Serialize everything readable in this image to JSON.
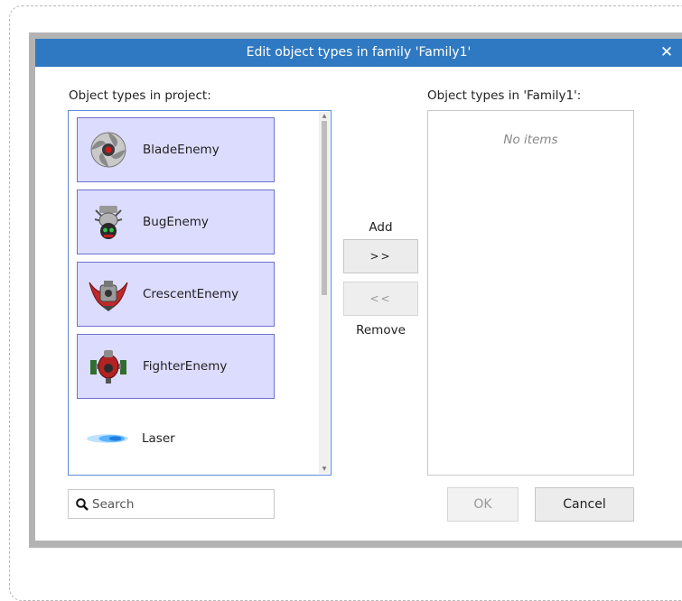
{
  "dialog": {
    "title": "Edit object types in family 'Family1'",
    "close_icon": "close-icon"
  },
  "project_list": {
    "label": "Object types in project:",
    "items": [
      {
        "label": "BladeEnemy",
        "icon": "blade-enemy-icon",
        "selected": true
      },
      {
        "label": "BugEnemy",
        "icon": "bug-enemy-icon",
        "selected": true
      },
      {
        "label": "CrescentEnemy",
        "icon": "crescent-enemy-icon",
        "selected": true
      },
      {
        "label": "FighterEnemy",
        "icon": "fighter-enemy-icon",
        "selected": true
      },
      {
        "label": "Laser",
        "icon": "laser-icon",
        "selected": false
      }
    ]
  },
  "family_list": {
    "label": "Object types in 'Family1':",
    "empty_text": "No items"
  },
  "transfer": {
    "add_label": "Add",
    "add_button": ">>",
    "remove_button": "<<",
    "remove_label": "Remove"
  },
  "search": {
    "placeholder": "Search",
    "value": ""
  },
  "footer": {
    "ok_label": "OK",
    "cancel_label": "Cancel"
  },
  "colors": {
    "titlebar": "#2f79c2",
    "selected_bg": "#dcdcff",
    "selected_border": "#6f70cf"
  }
}
